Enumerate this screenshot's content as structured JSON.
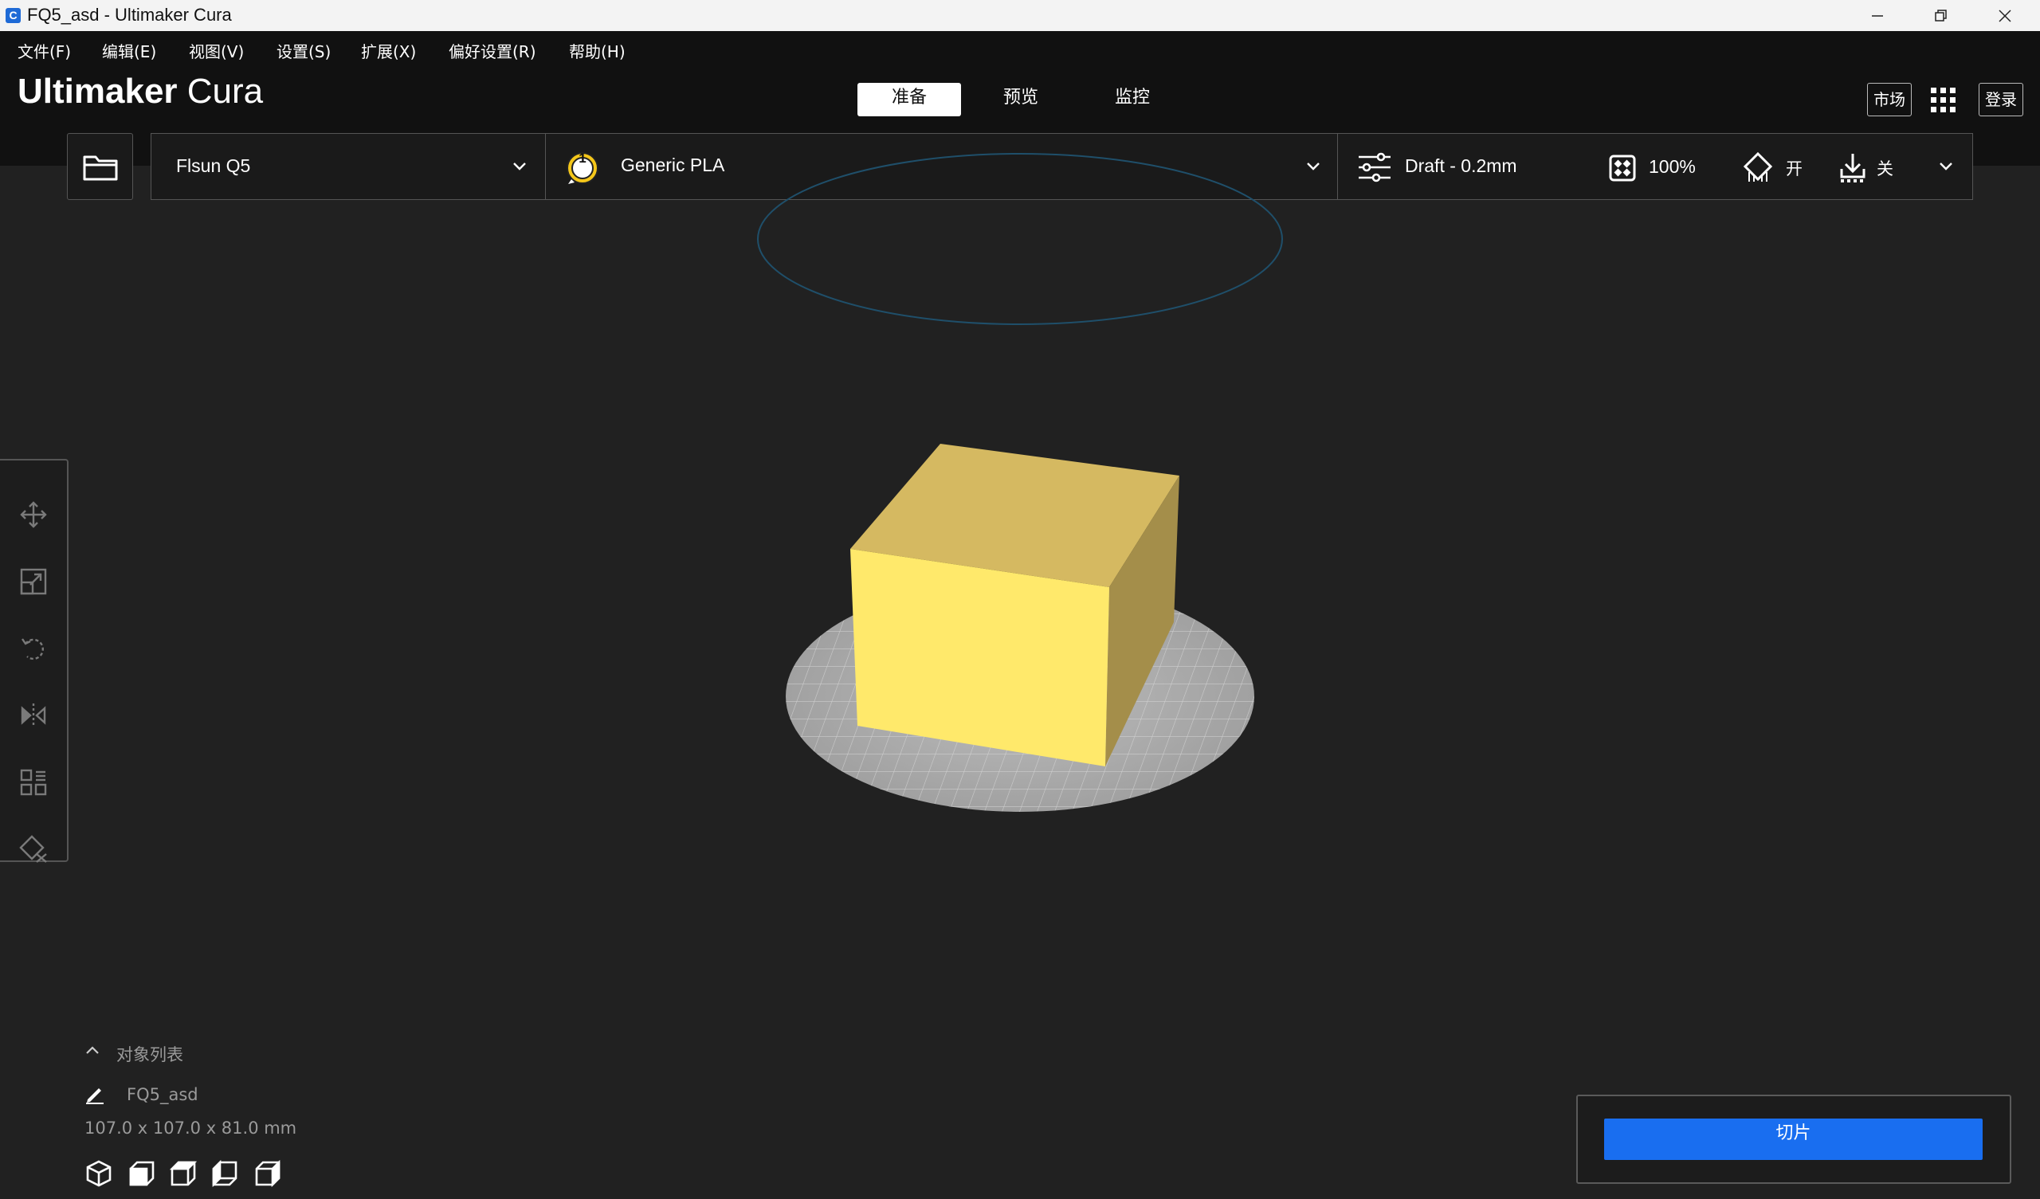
{
  "window": {
    "title": "FQ5_asd - Ultimaker Cura",
    "app_icon": "C"
  },
  "menu": [
    "文件(F)",
    "编辑(E)",
    "视图(V)",
    "设置(S)",
    "扩展(X)",
    "偏好设置(R)",
    "帮助(H)"
  ],
  "header": {
    "logo_bold": "Ultimaker",
    "logo_light": " Cura",
    "tabs": [
      {
        "label": "准备",
        "active": true
      },
      {
        "label": "预览",
        "active": false
      },
      {
        "label": "监控",
        "active": false
      }
    ],
    "marketplace_label": "市场",
    "signin_label": "登录"
  },
  "printer": {
    "name": "Flsun Q5"
  },
  "material": {
    "extruder_number": "1",
    "name": "Generic PLA"
  },
  "print_settings": {
    "profile": "Draft - 0.2mm",
    "infill": "100%",
    "support": "开",
    "adhesion": "关"
  },
  "object_list": {
    "title": "对象列表",
    "object_name": "FQ5_asd",
    "dimensions": "107.0 x 107.0 x 81.0 mm"
  },
  "slice": {
    "label": "切片"
  },
  "colors": {
    "accent": "#196ef0",
    "model_top": "#d8bc62",
    "model_front": "#ffe96a",
    "model_side": "#a08c48",
    "build_plate": "#b8b8b8"
  }
}
